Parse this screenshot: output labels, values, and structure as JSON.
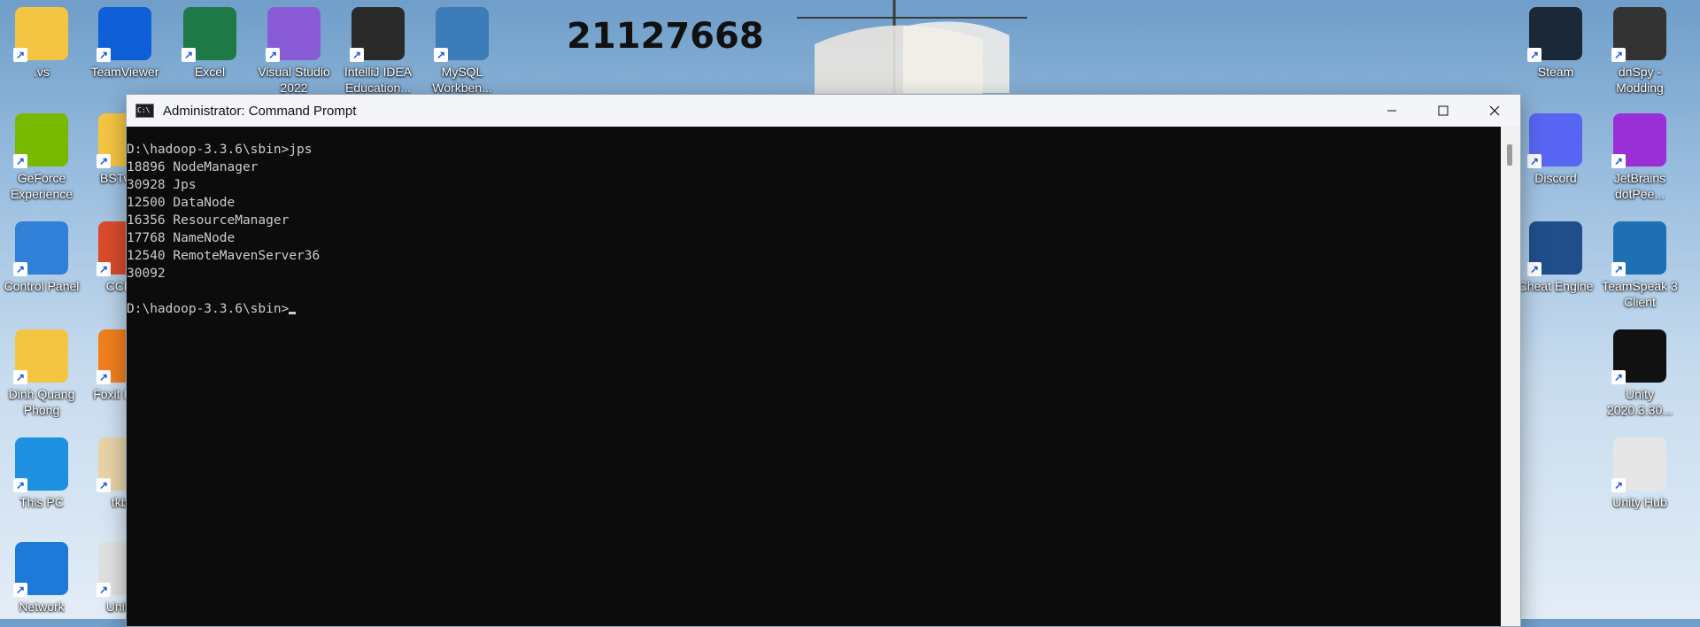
{
  "desktop": {
    "number": "21127668",
    "icons_left": [
      {
        "label": ".vs",
        "icon": "folder-icon",
        "color": "#f4c542"
      },
      {
        "label": "TeamViewer",
        "icon": "teamviewer-icon",
        "color": "#0e5fd8"
      },
      {
        "label": "Excel",
        "icon": "excel-icon",
        "color": "#1d7a46"
      },
      {
        "label": "Visual Studio 2022",
        "icon": "visual-studio-icon",
        "color": "#8a5bd6"
      },
      {
        "label": "IntelliJ IDEA Education...",
        "icon": "intellij-icon",
        "color": "#2a2a2a"
      },
      {
        "label": "MySQL Workben...",
        "icon": "mysql-workbench-icon",
        "color": "#3c7cb8"
      },
      {
        "label": "GeForce Experience",
        "icon": "geforce-icon",
        "color": "#76b900"
      },
      {
        "label": "BSTwe...",
        "icon": "folder-icon",
        "color": "#f4c542"
      },
      {
        "label": "Control Panel",
        "icon": "control-panel-icon",
        "color": "#2f80d6"
      },
      {
        "label": "CCle...",
        "icon": "ccleaner-icon",
        "color": "#d94b2b"
      },
      {
        "label": "Dinh Quang Phong",
        "icon": "user-folder-icon",
        "color": "#f4c542"
      },
      {
        "label": "Foxit Rea...",
        "icon": "foxit-icon",
        "color": "#f07f1d"
      },
      {
        "label": "This PC",
        "icon": "this-pc-icon",
        "color": "#1e90e0"
      },
      {
        "label": "tkb...",
        "icon": "file-icon",
        "color": "#e8d3a8"
      },
      {
        "label": "Network",
        "icon": "network-icon",
        "color": "#1e7ad8"
      },
      {
        "label": "Unity...",
        "icon": "file-icon",
        "color": "#e0e0e0"
      }
    ],
    "icons_right": [
      {
        "label": "Steam",
        "icon": "steam-icon",
        "color": "#1b2838"
      },
      {
        "label": "dnSpy - Modding",
        "icon": "dnspy-icon",
        "color": "#333333"
      },
      {
        "label": "Discord",
        "icon": "discord-icon",
        "color": "#5865f2"
      },
      {
        "label": "JetBrains dotPee...",
        "icon": "dotpeek-icon",
        "color": "#9b2fd6"
      },
      {
        "label": "Cheat Engine",
        "icon": "cheat-engine-icon",
        "color": "#1f4e8a"
      },
      {
        "label": "TeamSpeak 3 Client",
        "icon": "teamspeak-icon",
        "color": "#1f6fb3"
      },
      {
        "label": "Unity 2020.3.30...",
        "icon": "unity-icon",
        "color": "#111111"
      },
      {
        "label": "Unity Hub",
        "icon": "unity-hub-icon",
        "color": "#e6e6e6"
      }
    ]
  },
  "window": {
    "title": "Administrator: Command Prompt",
    "console_lines": [
      "D:\\hadoop-3.3.6\\sbin>jps",
      "18896 NodeManager",
      "30928 Jps",
      "12500 DataNode",
      "16356 ResourceManager",
      "17768 NameNode",
      "12540 RemoteMavenServer36",
      "30092",
      ""
    ],
    "prompt": "D:\\hadoop-3.3.6\\sbin>"
  }
}
